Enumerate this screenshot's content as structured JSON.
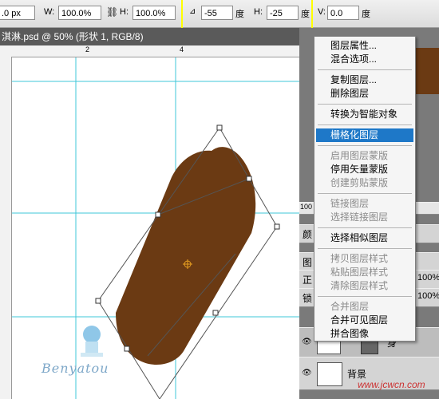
{
  "options_bar": {
    "x_value": ".0 px",
    "w_label": "W:",
    "w_value": "100.0%",
    "h_label": "H:",
    "h_value": "100.0%",
    "angle_value": "-55",
    "angle_unit": "度",
    "hskew_label": "H:",
    "hskew_value": "-25",
    "hskew_unit": "度",
    "vskew_label": "V:",
    "vskew_value": "0.0",
    "vskew_unit": "度"
  },
  "document": {
    "tab_title": "淇淋.psd @ 50% (形状 1, RGB/8)",
    "ruler_marks": [
      "2",
      "4"
    ],
    "shape_color": "#6b3a13"
  },
  "context_menu": {
    "items": [
      {
        "label": "图层属性...",
        "disabled": false
      },
      {
        "label": "混合选项...",
        "disabled": false
      },
      {
        "label": "复制图层...",
        "disabled": false
      },
      {
        "label": "删除图层",
        "disabled": false
      },
      {
        "label": "转换为智能对象",
        "disabled": false
      },
      {
        "label": "栅格化图层",
        "disabled": false,
        "selected": true
      },
      {
        "label": "启用图层蒙版",
        "disabled": true
      },
      {
        "label": "停用矢量蒙版",
        "disabled": false
      },
      {
        "label": "创建剪贴蒙版",
        "disabled": true
      },
      {
        "label": "链接图层",
        "disabled": true
      },
      {
        "label": "选择链接图层",
        "disabled": true
      },
      {
        "label": "选择相似图层",
        "disabled": false
      },
      {
        "label": "拷贝图层样式",
        "disabled": true
      },
      {
        "label": "粘贴图层样式",
        "disabled": true
      },
      {
        "label": "清除图层样式",
        "disabled": true
      },
      {
        "label": "合并图层",
        "disabled": true
      },
      {
        "label": "合并可见图层",
        "disabled": false
      },
      {
        "label": "拼合图像",
        "disabled": false
      }
    ]
  },
  "layers_panel": {
    "zoom": "100",
    "tab_color_label": "颜",
    "tab_layers_label": "图",
    "blend_mode": "正",
    "opacity": "100%",
    "lock_label": "锁",
    "fill": "100%",
    "layer_shape_name": "身",
    "layer_bg_name": "背景"
  },
  "watermark": {
    "text": "Benyatou",
    "site": "www.jcwcn.com"
  }
}
